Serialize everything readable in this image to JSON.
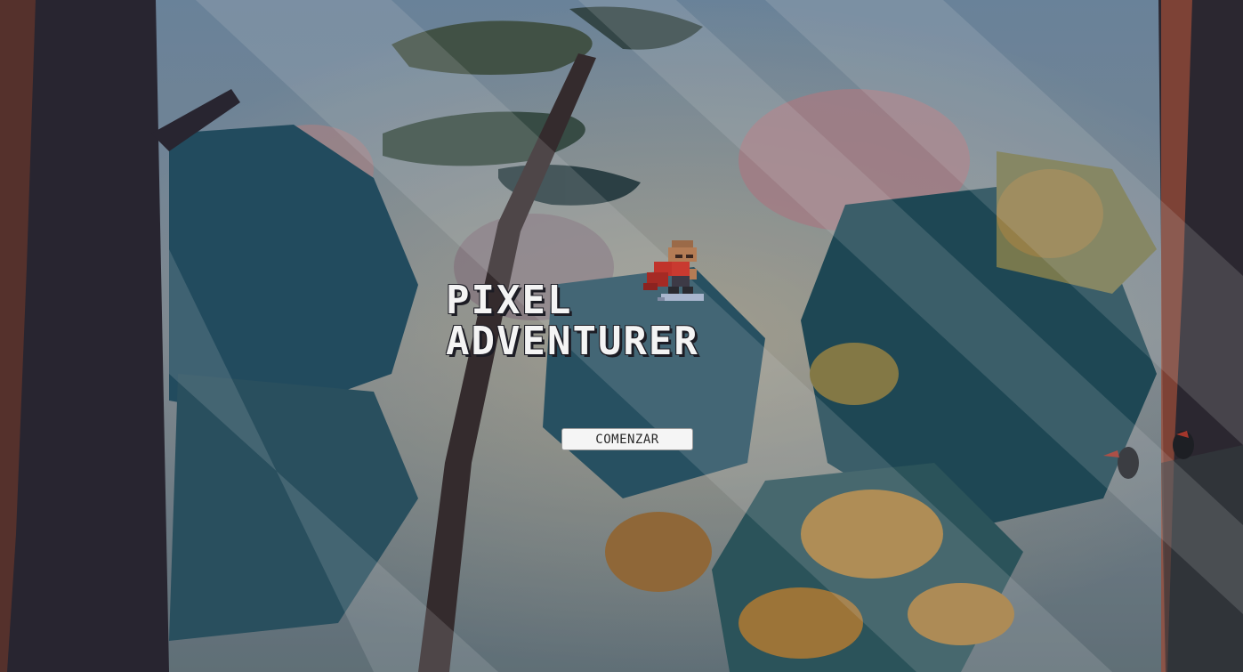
{
  "game": {
    "title_line_1": "PIXEL",
    "title_line_2": "ADVENTURER",
    "start_button_label": "COMENZAR"
  },
  "colors": {
    "sky": "#6f8ca6",
    "forest_teal": "#2c5d6e",
    "autumn_orange": "#c98f3e",
    "trunk_dark": "#2a2530",
    "button_bg": "#f5f5f5"
  },
  "icons": {
    "hero": "hero-sprite-icon"
  }
}
